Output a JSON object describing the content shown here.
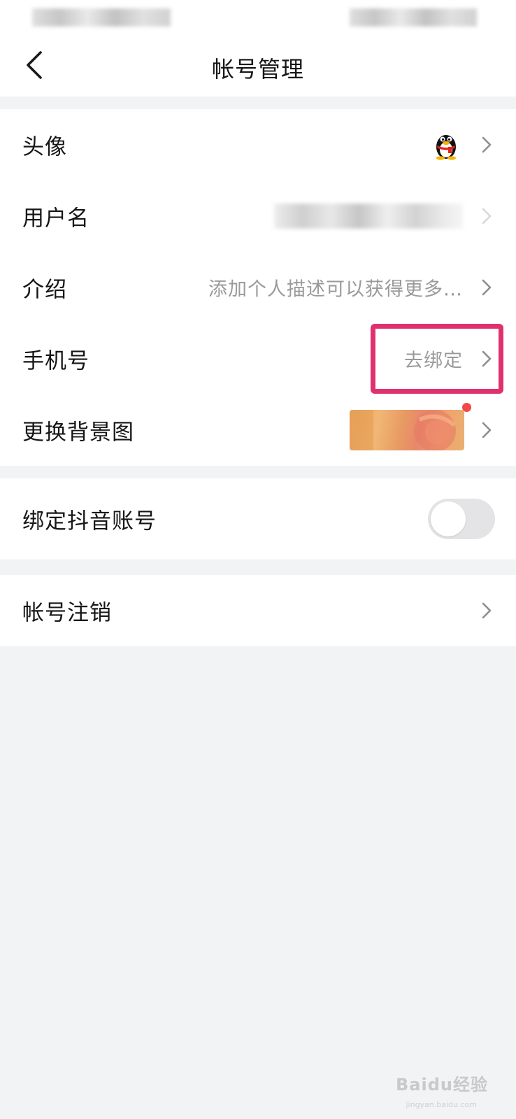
{
  "header": {
    "title": "帐号管理"
  },
  "profile_group": {
    "avatar_label": "头像",
    "username_label": "用户名",
    "intro_label": "介绍",
    "intro_placeholder": "添加个人描述可以获得更多…",
    "phone_label": "手机号",
    "phone_action": "去绑定",
    "background_label": "更换背景图"
  },
  "bind_group": {
    "douyin_label": "绑定抖音账号",
    "douyin_enabled": false
  },
  "cancel_group": {
    "cancel_label": "帐号注销"
  },
  "watermark": {
    "brand": "Baidu经验",
    "url": "jingyan.baidu.com"
  },
  "colors": {
    "highlight": "#e0316f",
    "background": "#f2f3f5",
    "dot": "#f24848"
  },
  "icons": [
    "back-arrow-icon",
    "chevron-right-icon",
    "qq-penguin-avatar-icon"
  ]
}
